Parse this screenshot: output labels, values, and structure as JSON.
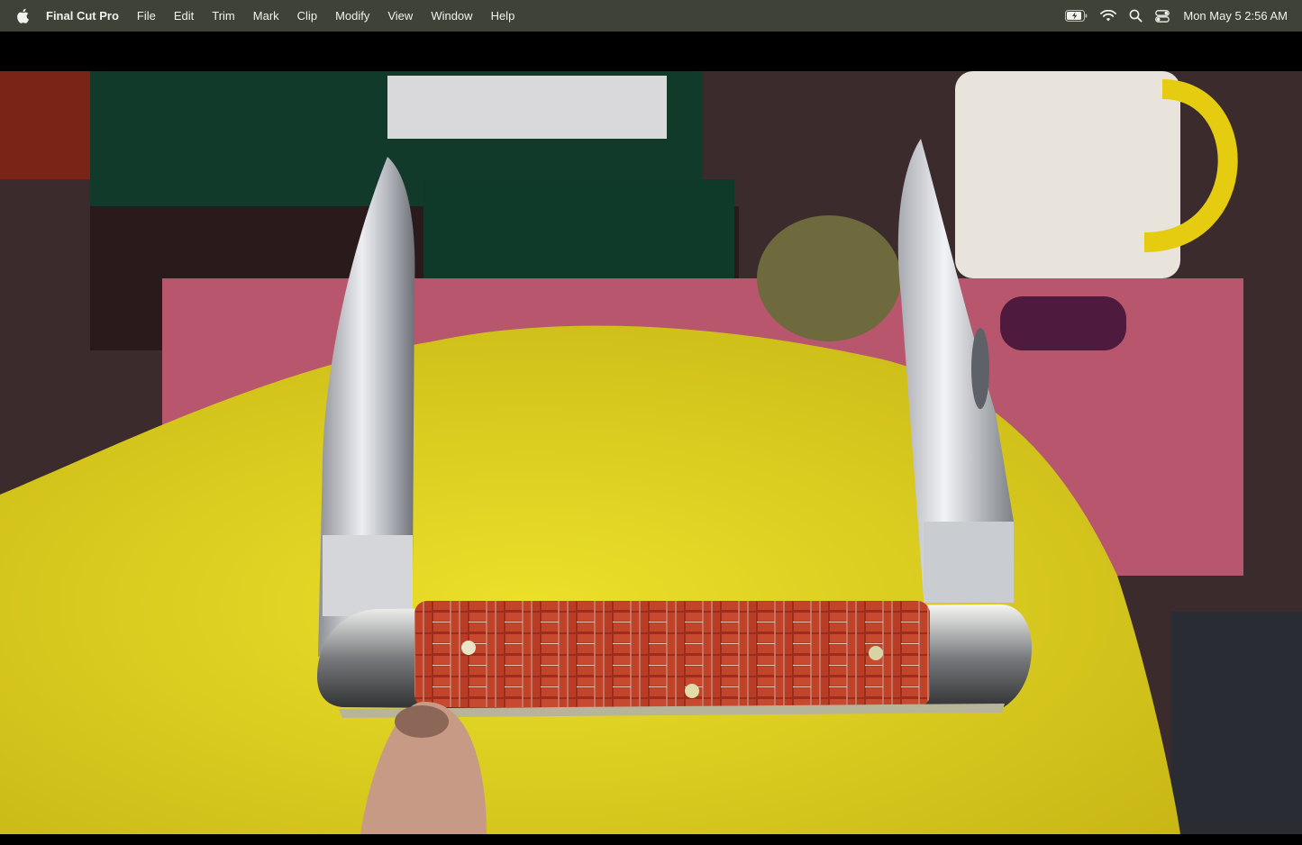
{
  "menubar": {
    "app_name": "Final Cut Pro",
    "menus": [
      "File",
      "Edit",
      "Trim",
      "Mark",
      "Clip",
      "Modify",
      "View",
      "Window",
      "Help"
    ],
    "status_icons": [
      "battery-charging-icon",
      "wifi-icon",
      "search-icon",
      "control-center-icon"
    ],
    "clock": "Mon May 5  2:56 AM"
  },
  "viewer": {
    "content": "video-frame"
  },
  "colors": {
    "menubar_bg": "#3f4236",
    "menubar_text": "#f2f2ee",
    "letterbox": "#000000"
  }
}
